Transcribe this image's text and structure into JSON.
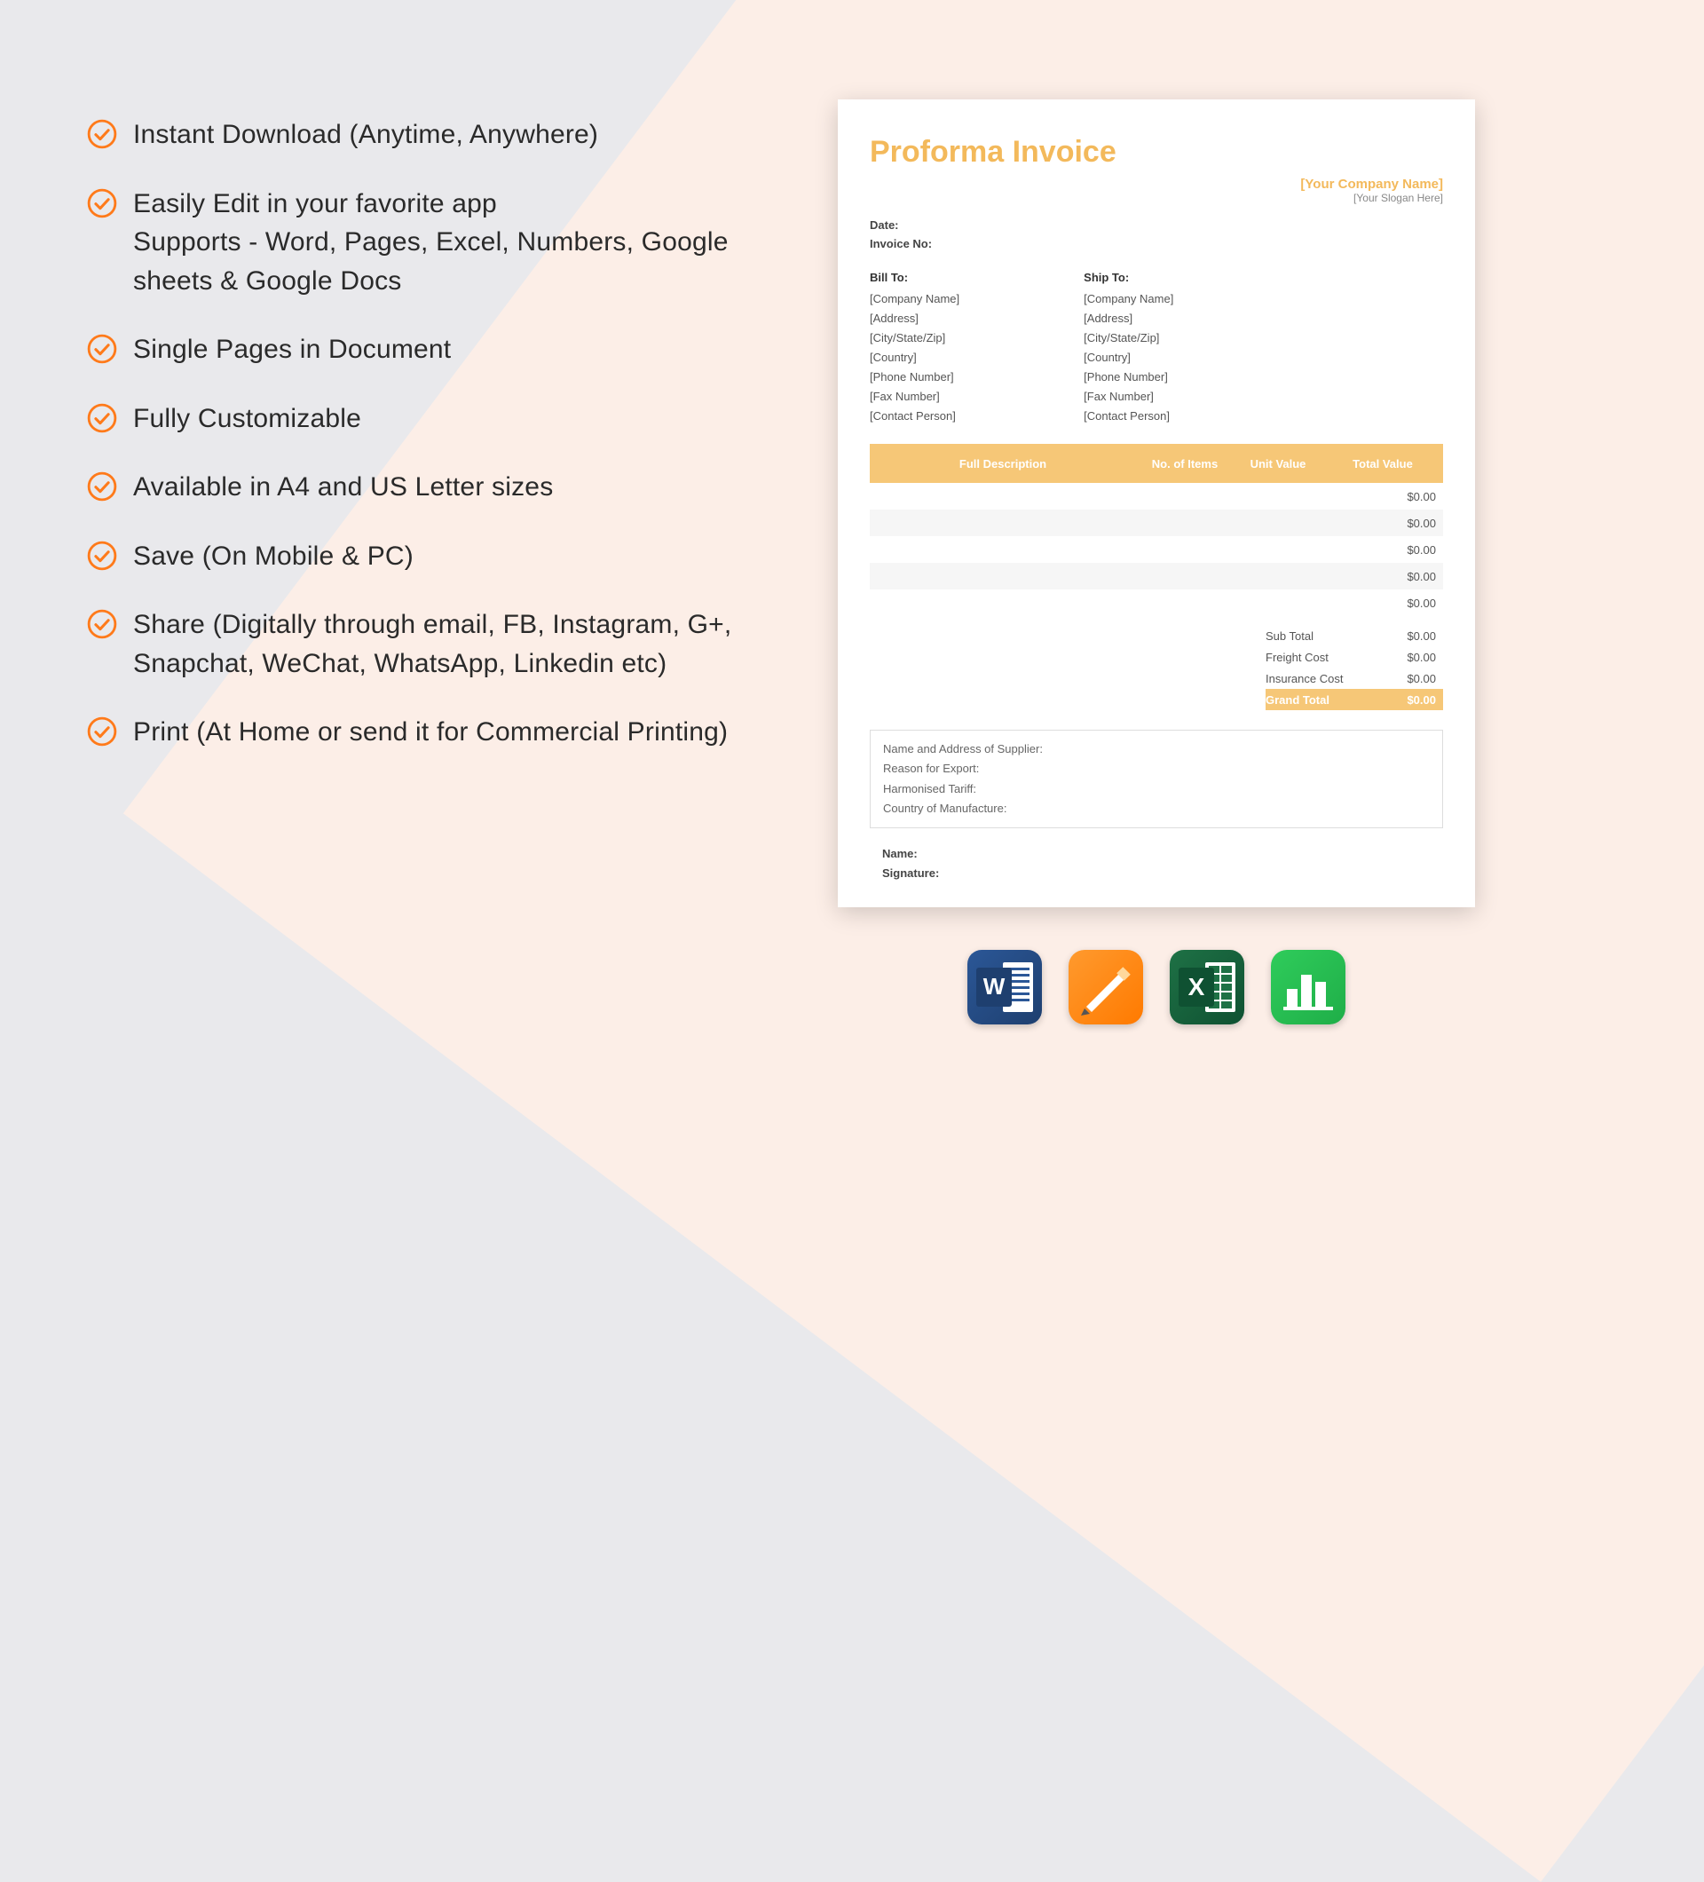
{
  "features": [
    "Instant Download (Anytime, Anywhere)",
    "Easily Edit in your favorite app\nSupports - Word, Pages, Excel, Numbers, Google sheets & Google Docs",
    "Single Pages in Document",
    "Fully Customizable",
    "Available in A4 and US Letter sizes",
    "Save (On Mobile & PC)",
    "Share (Digitally through email, FB, Instagram, G+, Snapchat, WeChat, WhatsApp, Linkedin etc)",
    "Print (At Home or send it for Commercial Printing)"
  ],
  "invoice": {
    "title": "Proforma Invoice",
    "company_name": "[Your Company Name]",
    "slogan": "[Your Slogan Here]",
    "date_label": "Date:",
    "invoice_no_label": "Invoice No:",
    "bill_to": {
      "header": "Bill To:",
      "lines": [
        "[Company Name]",
        "[Address]",
        "[City/State/Zip]",
        "[Country]",
        "[Phone Number]",
        "[Fax Number]",
        "[Contact Person]"
      ]
    },
    "ship_to": {
      "header": "Ship To:",
      "lines": [
        "[Company Name]",
        "[Address]",
        "[City/State/Zip]",
        "[Country]",
        "[Phone Number]",
        "[Fax Number]",
        "[Contact Person]"
      ]
    },
    "columns": {
      "description": "Full Description",
      "items": "No. of Items",
      "unit": "Unit Value",
      "total": "Total Value"
    },
    "row_values": [
      "$0.00",
      "$0.00",
      "$0.00",
      "$0.00",
      "$0.00"
    ],
    "totals": {
      "sub": {
        "label": "Sub Total",
        "value": "$0.00"
      },
      "freight": {
        "label": "Freight Cost",
        "value": "$0.00"
      },
      "insurance": {
        "label": "Insurance Cost",
        "value": "$0.00"
      },
      "grand": {
        "label": "Grand Total",
        "value": "$0.00"
      }
    },
    "notes": [
      "Name and Address of Supplier:",
      "Reason for Export:",
      "Harmonised Tariff:",
      "Country of Manufacture:"
    ],
    "signature": {
      "name": "Name:",
      "sig": "Signature:"
    }
  },
  "apps": [
    "word",
    "pages",
    "excel",
    "numbers"
  ]
}
